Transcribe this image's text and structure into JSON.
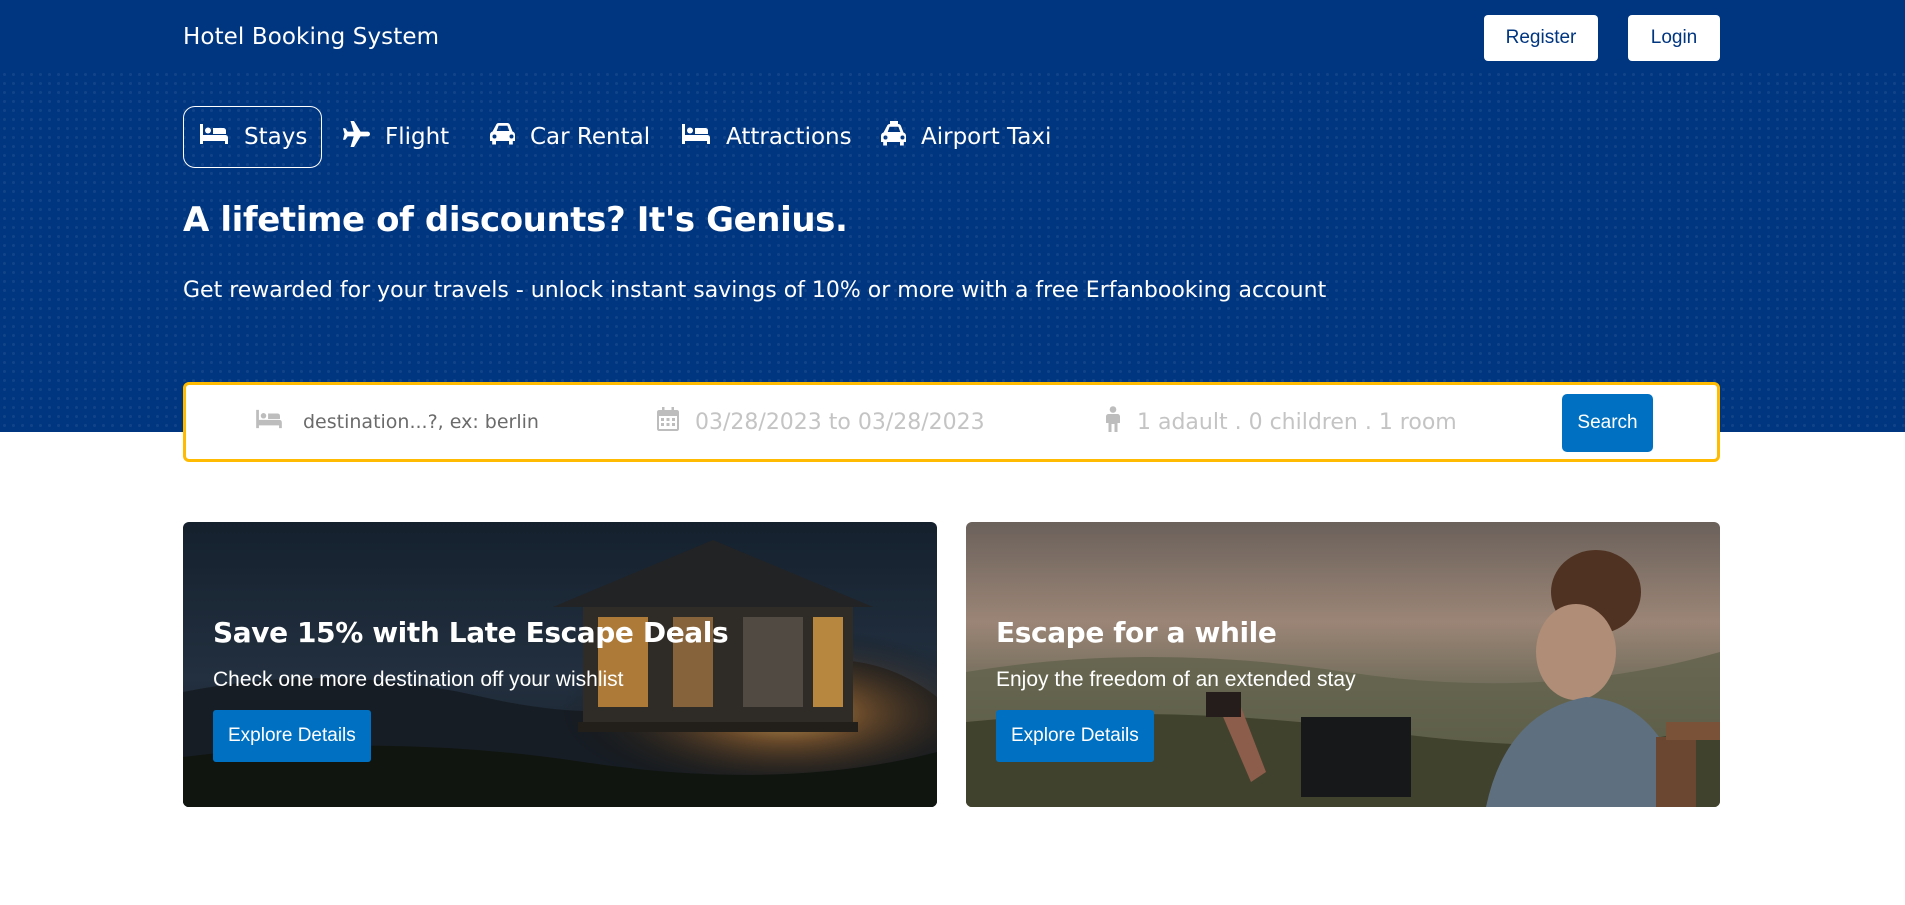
{
  "header": {
    "brand": "Hotel Booking System",
    "register_label": "Register",
    "login_label": "Login"
  },
  "nav": {
    "items": [
      {
        "label": "Stays",
        "icon": "bed-icon",
        "active": true
      },
      {
        "label": "Flight",
        "icon": "plane-icon"
      },
      {
        "label": "Car Rental",
        "icon": "car-icon"
      },
      {
        "label": "Attractions",
        "icon": "bed-icon"
      },
      {
        "label": "Airport Taxi",
        "icon": "taxi-icon"
      }
    ]
  },
  "hero": {
    "headline": "A lifetime of discounts? It's Genius.",
    "subline": "Get rewarded for your travels - unlock instant savings of 10% or more with a free Erfanbooking account"
  },
  "search": {
    "destination_placeholder": "destination...?, ex: berlin",
    "dates": "03/28/2023 to 03/28/2023",
    "guests": "1 adault . 0 children . 1 room",
    "button_label": "Search"
  },
  "cards": [
    {
      "title": "Save 15% with Late Escape Deals",
      "text": "Check one more destination off your wishlist",
      "button_label": "Explore Details"
    },
    {
      "title": "Escape for a while",
      "text": "Enjoy the freedom of an extended stay",
      "button_label": "Explore Details"
    }
  ],
  "colors": {
    "hero_bg": "#003580",
    "accent_blue": "#0071c2",
    "search_border": "#febb02"
  }
}
